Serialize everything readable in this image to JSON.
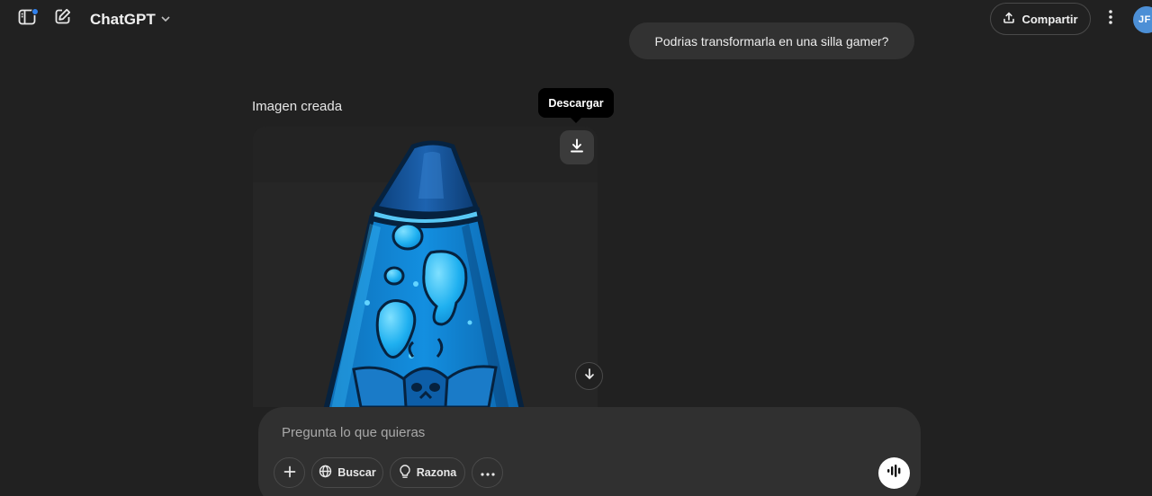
{
  "header": {
    "model_name": "ChatGPT",
    "share_label": "Compartir",
    "avatar_initials": "JF",
    "icons": [
      "sidebar-icon",
      "new-chat-icon",
      "chevron-down-icon",
      "share-icon",
      "more-vertical-icon"
    ]
  },
  "conversation": {
    "user_message": "Podrias transformarla en una silla gamer?",
    "image_label": "Imagen creada",
    "download_tooltip": "Descargar"
  },
  "composer": {
    "placeholder": "Pregunta lo que quieras",
    "search_label": "Buscar",
    "reason_label": "Razona"
  },
  "colors": {
    "background": "#212121",
    "bubble": "#323232",
    "composer": "#303030",
    "accent_dot": "#2f80ed",
    "avatar": "#4c8fd6",
    "lava_blue": "#1aa3e8"
  }
}
